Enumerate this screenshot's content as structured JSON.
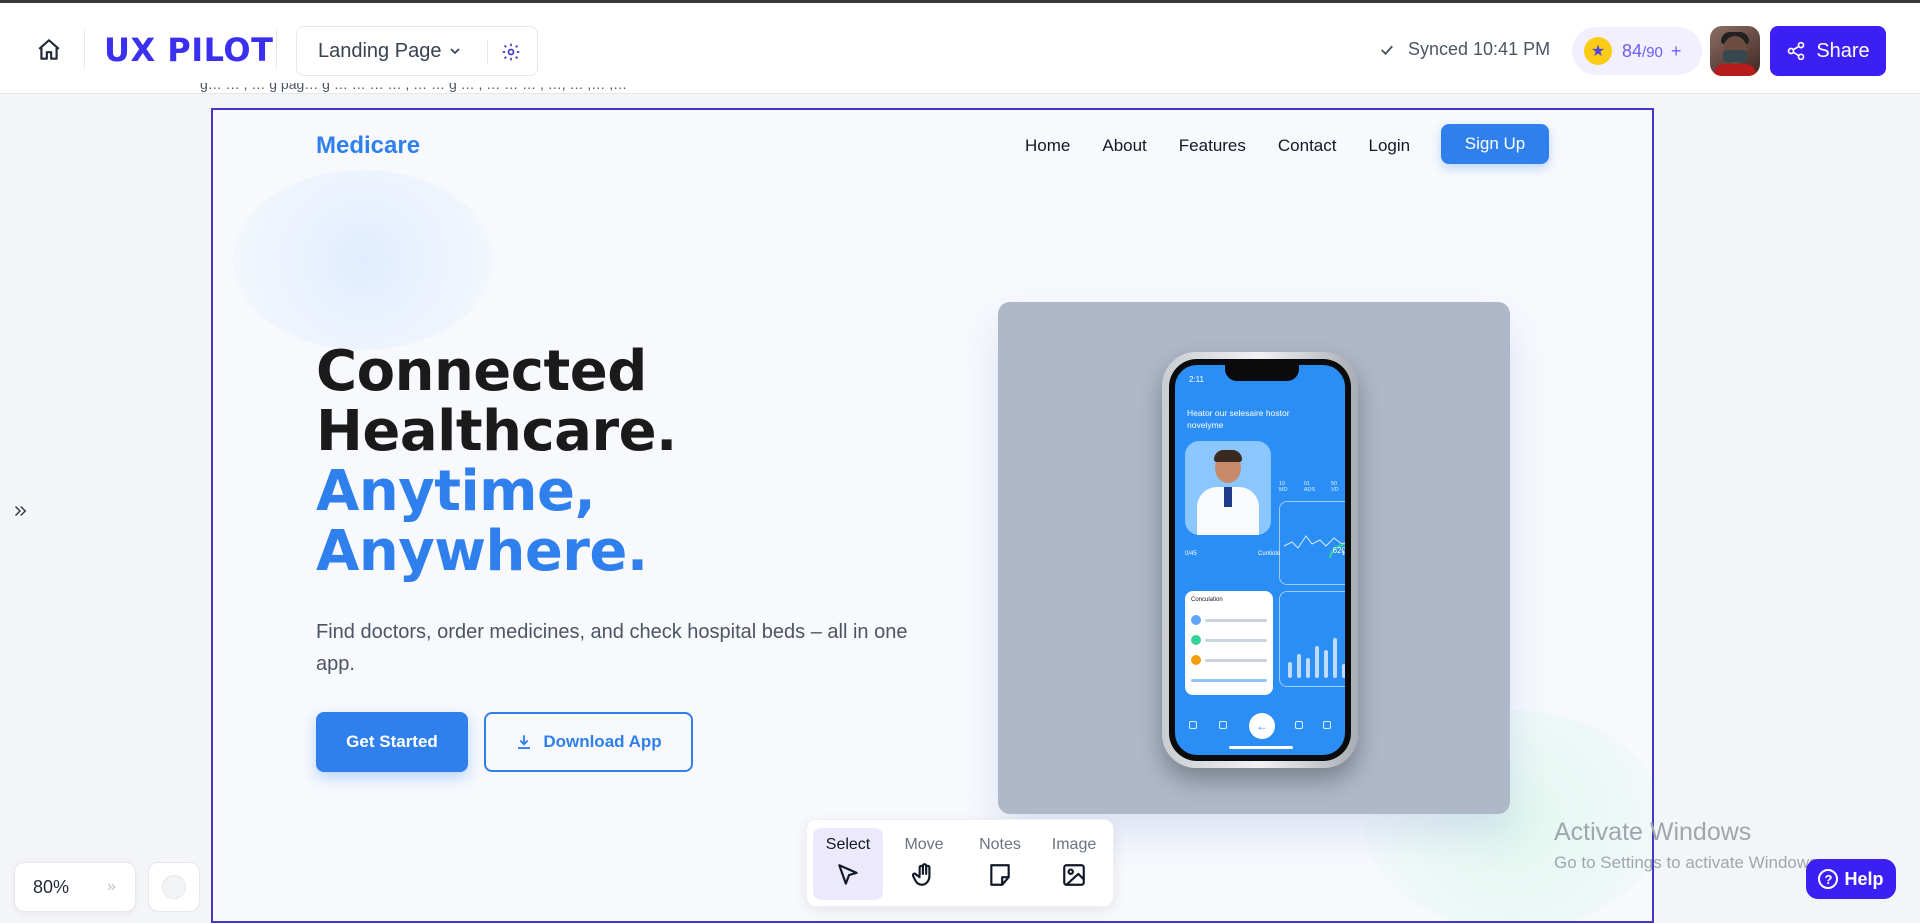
{
  "topbar": {
    "brand": "UX PILOT",
    "page_name": "Landing Page",
    "sync_status": "Synced 10:41 PM",
    "credits_used": "84",
    "credits_total": "/90",
    "credits_plus": "+",
    "share_label": "Share"
  },
  "prompt_strip": "g… … , … g pag… g … … … … , … … g … , … … … , …, … ,… ,…",
  "site": {
    "logo": "Medicare",
    "nav": [
      "Home",
      "About",
      "Features",
      "Contact",
      "Login"
    ],
    "signup_label": "Sign Up",
    "hero_line1": "Connected",
    "hero_line2": "Healthcare.",
    "hero_line3": "Anytime,",
    "hero_line4": "Anywhere.",
    "subtext": "Find doctors, order medicines, and check hospital beds – all in one app.",
    "cta_primary": "Get Started",
    "cta_secondary": "Download App",
    "phone": {
      "time": "2:11",
      "title": "Heator our selesaire hostor novelyme",
      "tabs": [
        "10 MD",
        "01 ADS",
        "50 VD"
      ],
      "stats": [
        "0/45",
        "Cuntiote",
        "1515"
      ],
      "reading": "620",
      "list_title": "Conculation"
    }
  },
  "zoom_level": "80%",
  "toolbar": {
    "tools": [
      "Select",
      "Move",
      "Notes",
      "Image"
    ],
    "active": "Select"
  },
  "watermark": {
    "line1": "Activate Windows",
    "line2": "Go to Settings to activate Windows."
  },
  "help_label": "Help",
  "colors": {
    "brand": "#3b1ff5",
    "site_accent": "#2f80ed",
    "frame_border": "#4338ca"
  }
}
